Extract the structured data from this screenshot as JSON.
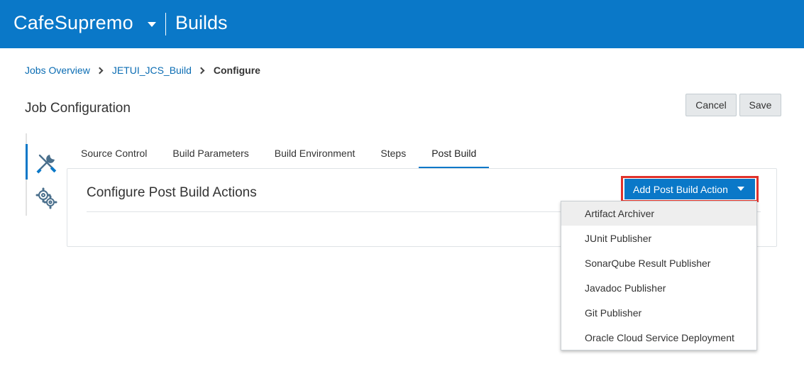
{
  "header": {
    "app_name": "CafeSupremo",
    "section": "Builds",
    "bg_color": "#0a78c8"
  },
  "breadcrumb": {
    "items": [
      "Jobs Overview",
      "JETUI_JCS_Build"
    ],
    "current": "Configure"
  },
  "page": {
    "title": "Job Configuration",
    "cancel_label": "Cancel",
    "save_label": "Save"
  },
  "side_nav": {
    "icons": [
      "tools-icon",
      "gears-icon"
    ]
  },
  "tabs": [
    {
      "label": "Source Control",
      "active": false
    },
    {
      "label": "Build Parameters",
      "active": false
    },
    {
      "label": "Build Environment",
      "active": false
    },
    {
      "label": "Steps",
      "active": false
    },
    {
      "label": "Post Build",
      "active": true
    }
  ],
  "panel": {
    "title": "Configure Post Build Actions",
    "add_action_label": "Add Post Build Action",
    "highlight_color": "#e0322b"
  },
  "dropdown": {
    "items": [
      "Artifact Archiver",
      "JUnit Publisher",
      "SonarQube Result Publisher",
      "Javadoc Publisher",
      "Git Publisher",
      "Oracle Cloud Service Deployment"
    ]
  }
}
